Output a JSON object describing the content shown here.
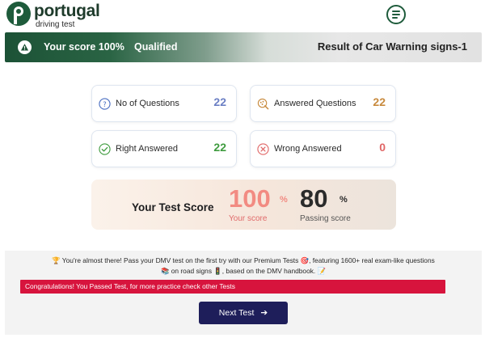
{
  "brand": {
    "title": "portugal",
    "subtitle": "driving test"
  },
  "result_bar": {
    "score_text": "Your score 100%",
    "status_text": "Qualified",
    "title": "Result of Car Warning signs-1"
  },
  "stats": {
    "questions": {
      "label": "No of Questions",
      "value": "22"
    },
    "answered": {
      "label": "Answered Questions",
      "value": "22"
    },
    "right": {
      "label": "Right Answered",
      "value": "22"
    },
    "wrong": {
      "label": "Wrong Answered",
      "value": "0"
    }
  },
  "score": {
    "label": "Your Test Score",
    "your_value": "100",
    "your_unit": "%",
    "your_caption": "Your score",
    "passing_value": "80",
    "passing_unit": "%",
    "passing_caption": "Passing score"
  },
  "promo": {
    "line1": "🏆 You're almost there! Pass your DMV test on the first try with our Premium Tests 🎯, featuring 1600+ real exam-like questions",
    "line2": "📚 on road signs 🚦, based on the DMV handbook. 📝"
  },
  "alert": {
    "text": "Congratulations! You Passed Test, for more practice check other Tests"
  },
  "next_button": {
    "label": "Next Test",
    "arrow": "➔"
  },
  "colors": {
    "brand_green": "#1e5b3b",
    "questions_value": "#6b7fc4",
    "answered_value": "#c88a3d",
    "right_value": "#3e9b3e",
    "wrong_value": "#e06666",
    "your_score": "#f28b82",
    "alert_red": "#d7143d",
    "button_navy": "#1e1e5a"
  },
  "icons": {
    "menu": "hamburger-menu-icon",
    "result": "warning-icon",
    "questions": "question-circle-icon",
    "answered": "answered-questions-icon",
    "right": "check-circle-icon",
    "wrong": "x-circle-icon",
    "next": "arrow-right-icon"
  }
}
